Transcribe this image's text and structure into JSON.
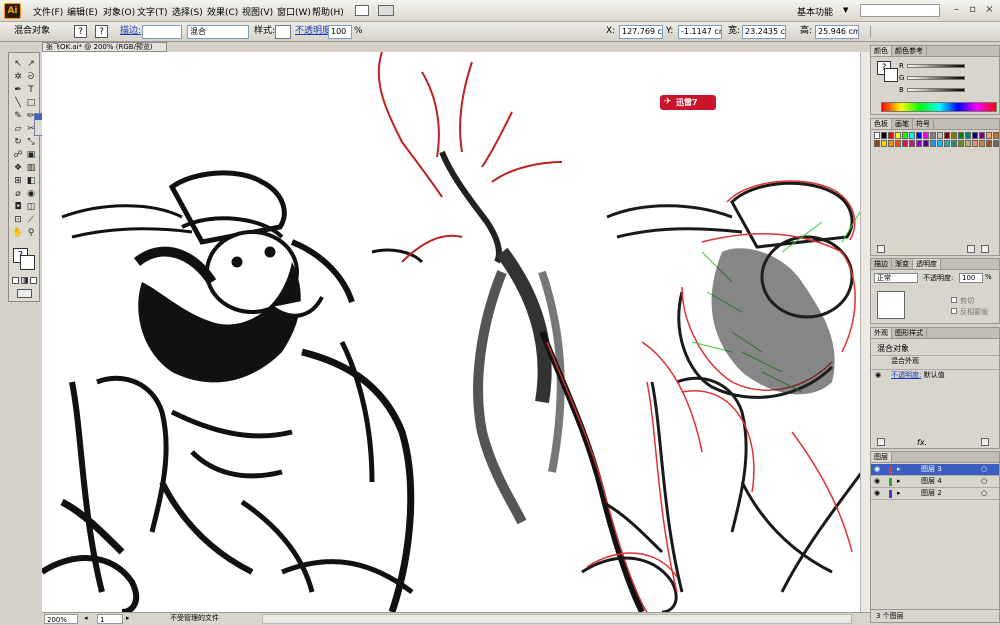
{
  "menubar": {
    "logo": "Ai",
    "items": [
      "文件(F)",
      "编辑(E)",
      "对象(O)",
      "文字(T)",
      "选择(S)",
      "效果(C)",
      "视图(V)",
      "窗口(W)",
      "帮助(H)"
    ],
    "workspace": "基本功能"
  },
  "control": {
    "object_label": "混合对象",
    "stroke_label": "描边:",
    "blend_value": "混合",
    "style_label": "样式:",
    "opacity_label": "不透明度:",
    "opacity_value": "100",
    "percent": "%",
    "x_label": "X:",
    "x_value": "127.769 cm",
    "y_label": "Y:",
    "y_value": "-1.1147 cm",
    "w_label": "宽:",
    "w_value": "23.2435 cm",
    "h_label": "高:",
    "h_value": "25.946 cm"
  },
  "document": {
    "tab": "张飞OK.ai* @ 200% (RGB/预览)"
  },
  "status": {
    "zoom": "200%",
    "page": "1",
    "info": "不受管理的文件"
  },
  "overlay": {
    "xunlei": "迅雷7"
  },
  "color_panel": {
    "tabs": [
      "颜色",
      "颜色参考"
    ],
    "channels": [
      "R",
      "G",
      "B"
    ]
  },
  "swatch_panel": {
    "tabs": [
      "色板",
      "画笔",
      "符号"
    ]
  },
  "transparency_panel": {
    "tabs": [
      "描边",
      "渐变",
      "透明度"
    ],
    "mode": "正常",
    "opacity_label": "不透明度:",
    "opacity_value": "100",
    "percent": "%",
    "clip": "剪切",
    "invert": "反相蒙版"
  },
  "appearance_panel": {
    "tabs": [
      "外观",
      "图形样式"
    ],
    "title": "混合对象",
    "row1": "混合外观",
    "row2_label": "不透明度:",
    "row2_value": "默认值"
  },
  "layers_panel": {
    "tabs": [
      "图层"
    ],
    "layers": [
      "图层 3",
      "图层 4",
      "图层 2"
    ],
    "layer_colors": [
      "#e03c3c",
      "#3c9c3c",
      "#3c3ce0"
    ],
    "footer": "3 个图层"
  },
  "swatches": [
    "#ffffff",
    "#000000",
    "#ff0000",
    "#ffff00",
    "#00ff00",
    "#00ffff",
    "#0000ff",
    "#ff00ff",
    "#808080",
    "#c0c0c0",
    "#800000",
    "#808000",
    "#008000",
    "#008080",
    "#000080",
    "#800080",
    "#f4a460",
    "#d2691e",
    "#8b4513",
    "#ffd700",
    "#ff8c00",
    "#ff4500",
    "#dc143c",
    "#c71585",
    "#9400d3",
    "#4b0082",
    "#1e90ff",
    "#00bfff",
    "#20b2aa",
    "#2e8b57",
    "#6b8e23",
    "#bdb76b",
    "#e9967a",
    "#cd853f",
    "#a0522d",
    "#696969"
  ]
}
